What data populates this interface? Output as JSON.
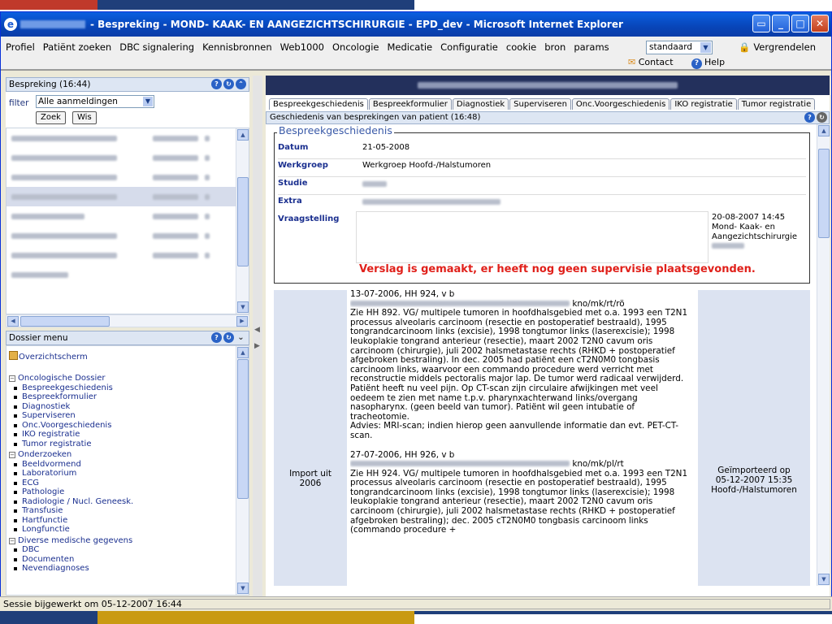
{
  "window": {
    "title": "- Bespreking - MOND- KAAK- EN AANGEZICHTSCHIRURGIE - EPD_dev - Microsoft Internet Explorer"
  },
  "menu": {
    "items": [
      "Profiel",
      "Patiënt zoeken",
      "DBC signalering",
      "Kennisbronnen",
      "Web1000",
      "Oncologie",
      "Medicatie",
      "Configuratie",
      "cookie",
      "bron",
      "params"
    ],
    "select_value": "standaard",
    "lock": "Vergrendelen",
    "contact": "Contact",
    "help": "Help"
  },
  "bespreking": {
    "header": "Bespreking (16:44)",
    "filter_label": "filter",
    "filter_value": "Alle aanmeldingen",
    "zoek": "Zoek",
    "wis": "Wis"
  },
  "dossier": {
    "header": "Dossier menu",
    "overzicht": "Overzichtscherm",
    "groups": [
      {
        "title": "Oncologische Dossier",
        "items": [
          "Bespreekgeschiedenis",
          "Bespreekformulier",
          "Diagnostiek",
          "Superviseren",
          "Onc.Voorgeschiedenis",
          "IKO registratie",
          "Tumor registratie"
        ]
      },
      {
        "title": "Onderzoeken",
        "items": [
          "Beeldvormend",
          "Laboratorium",
          "ECG",
          "Pathologie",
          "Radiologie / Nucl. Geneesk.",
          "Transfusie",
          "Hartfunctie",
          "Longfunctie"
        ]
      },
      {
        "title": "Diverse medische gegevens",
        "items": [
          "DBC",
          "Documenten",
          "Nevendiagnoses"
        ]
      }
    ]
  },
  "tabs": [
    "Bespreekgeschiedenis",
    "Bespreekformulier",
    "Diagnostiek",
    "Superviseren",
    "Onc.Voorgeschiedenis",
    "IKO registratie",
    "Tumor registratie"
  ],
  "section": {
    "header": "Geschiedenis van besprekingen van patient (16:48)",
    "legend": "Bespreekgeschiedenis",
    "datum_label": "Datum",
    "datum": "21-05-2008",
    "werkgroep_label": "Werkgroep",
    "werkgroep": "Werkgroep Hoofd-/Halstumoren",
    "studie_label": "Studie",
    "extra_label": "Extra",
    "vraag_label": "Vraagstelling",
    "vraag_date": "20-08-2007 14:45",
    "vraag_dept1": "Mond- Kaak- en",
    "vraag_dept2": "Aangezichtschirurgie",
    "warning": "Verslag is gemaakt, er heeft nog geen supervisie plaatsgevonden."
  },
  "import": {
    "left1": "Import uit",
    "left2": "2006",
    "right1": "Geïmporteerd op",
    "right2": "05-12-2007 15:35",
    "right3": "Hoofd-/Halstumoren",
    "text1_head": "13-07-2006, HH 924, v b",
    "text1_code": "kno/mk/rt/rö",
    "text1_body": "Zie HH 892. VG/ multipele tumoren in hoofdhalsgebied met o.a. 1993 een T2N1 processus alveolaris carcinoom (resectie en postoperatief bestraald), 1995 tongrandcarcinoom links (excisie), 1998 tongtumor links (laserexcisie); 1998 leukoplakie tongrand anterieur (resectie), maart 2002 T2N0 cavum oris carcinoom (chirurgie), juli 2002 halsmetastase rechts (RHKD + postoperatief afgebroken bestraling). In dec. 2005 had patiënt een cT2N0M0 tongbasis carcinoom links, waarvoor een commando procedure werd verricht met reconstructie middels pectoralis major lap. De tumor werd radicaal verwijderd. Patiënt heeft nu veel pijn. Op CT-scan zijn circulaire afwijkingen met veel oedeem te zien met name t.p.v. pharynxachterwand links/overgang nasopharynx. (geen beeld van tumor). Patiënt wil geen intubatie of tracheotomie.",
    "text1_advies": "Advies: MRI-scan; indien hierop geen aanvullende informatie dan evt. PET-CT-scan.",
    "text2_head": "27-07-2006, HH 926, v b",
    "text2_code": "kno/mk/pl/rt",
    "text2_body": "Zie HH 924. VG/ multipele tumoren in hoofdhalsgebied met o.a. 1993 een T2N1 processus alveolaris carcinoom (resectie en postoperatief bestraald), 1995 tongrandcarcinoom links (excisie), 1998 tongtumor links (laserexcisie); 1998 leukoplakie tongrand anterieur (resectie), maart 2002 T2N0 cavum oris carcinoom (chirurgie), juli 2002 halsmetastase rechts (RHKD + postoperatief afgebroken bestraling); dec. 2005 cT2N0M0 tongbasis carcinoom links (commando procedure +"
  },
  "status": {
    "text": "Sessie bijgewerkt om 05-12-2007 16:44"
  }
}
